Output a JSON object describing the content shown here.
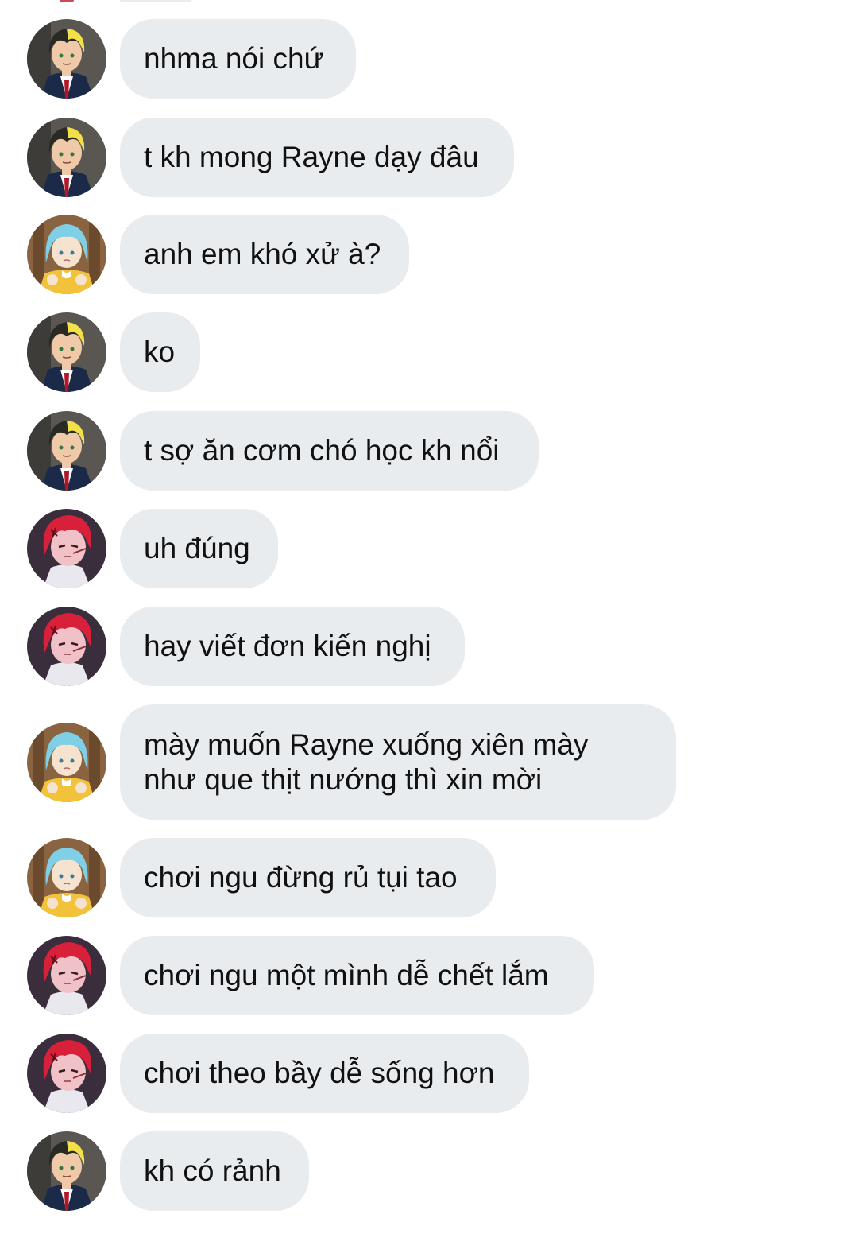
{
  "users": {
    "yellow_black_hair": {
      "avatar_icon": "yellow-black-hair-boy-avatar-icon",
      "colors": {
        "hair": "#2a2a24",
        "streak": "#f2e04a",
        "skin": "#f0c9a8",
        "suit": "#1c2a4a",
        "tie": "#b0182a",
        "bg": "#5a5752"
      }
    },
    "blue_hair": {
      "avatar_icon": "blue-hair-girl-avatar-icon",
      "colors": {
        "hair": "#7fd0e6",
        "skin": "#f6e3cf",
        "dress": "#f2c23a",
        "bg": "#8a6440"
      }
    },
    "red_hair": {
      "avatar_icon": "red-hair-boy-avatar-icon",
      "colors": {
        "hair": "#d8203a",
        "skin": "#f1c1c8",
        "shirt": "#e8e8ee",
        "bg": "#3a2e3c"
      }
    }
  },
  "messages": [
    {
      "sender": "yellow_black_hair",
      "text": "nhma nói chứ"
    },
    {
      "sender": "yellow_black_hair",
      "text": "t kh mong Rayne dạy đâu"
    },
    {
      "sender": "blue_hair",
      "text": "anh em khó xử à?"
    },
    {
      "sender": "yellow_black_hair",
      "text": "ko"
    },
    {
      "sender": "yellow_black_hair",
      "text": "t sợ ăn cơm chó học kh nổi"
    },
    {
      "sender": "red_hair",
      "text": "uh đúng"
    },
    {
      "sender": "red_hair",
      "text": "hay viết đơn kiến nghị"
    },
    {
      "sender": "blue_hair",
      "text": "mày muốn Rayne xuống xiên mày\nnhư que thịt nướng thì xin mời"
    },
    {
      "sender": "blue_hair",
      "text": "chơi ngu đừng rủ tụi tao"
    },
    {
      "sender": "red_hair",
      "text": "chơi ngu một mình dễ chết lắm"
    },
    {
      "sender": "red_hair",
      "text": "chơi theo bầy dễ sống hơn"
    },
    {
      "sender": "yellow_black_hair",
      "text": "kh có rảnh"
    }
  ]
}
